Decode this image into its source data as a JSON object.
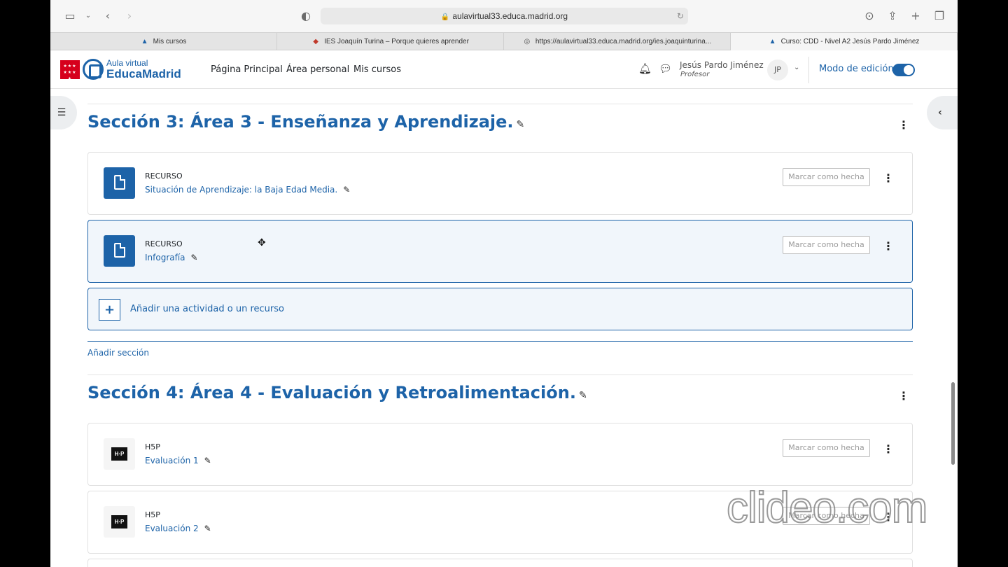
{
  "browser": {
    "url": "aulavirtual33.educa.madrid.org",
    "tabs": [
      {
        "label": "Mis cursos",
        "active": false
      },
      {
        "label": "IES Joaquín Turina – Porque quieres aprender",
        "active": false
      },
      {
        "label": "https://aulavirtual33.educa.madrid.org/ies.joaquinturina...",
        "active": false
      },
      {
        "label": "Curso: CDD - Nivel A2 Jesús Pardo Jiménez",
        "active": true
      }
    ]
  },
  "header": {
    "logo_small": "Aula virtual",
    "logo_big": "EducaMadrid",
    "nav": [
      "Página Principal",
      "Área personal",
      "Mis cursos"
    ],
    "user_name": "Jesús Pardo Jiménez",
    "user_role": "Profesor",
    "avatar_initials": "JP",
    "edit_mode_label": "Modo de edición",
    "edit_mode_on": true
  },
  "sections": [
    {
      "title": "Sección 3: Área 3 - Enseñanza y Aprendizaje.",
      "activities": [
        {
          "type": "RECURSO",
          "name": "Situación de Aprendizaje: la Baja Edad Media.",
          "button": "Marcar como hecha"
        },
        {
          "type": "RECURSO",
          "name": "Infografía",
          "button": "Marcar como hecha"
        }
      ],
      "add_activity": "Añadir una actividad o un recurso",
      "add_section": "Añadir sección"
    },
    {
      "title": "Sección 4: Área 4 - Evaluación y Retroalimentación.",
      "activities": [
        {
          "type": "H5P",
          "name": "Evaluación 1",
          "button": "Marcar como hecha"
        },
        {
          "type": "H5P",
          "name": "Evaluación 2",
          "button": "Marcar como hecha"
        }
      ]
    }
  ],
  "watermark": "clideo.com",
  "colors": {
    "accent": "#1d63a8",
    "highlight_bg": "#f1f6fb"
  }
}
